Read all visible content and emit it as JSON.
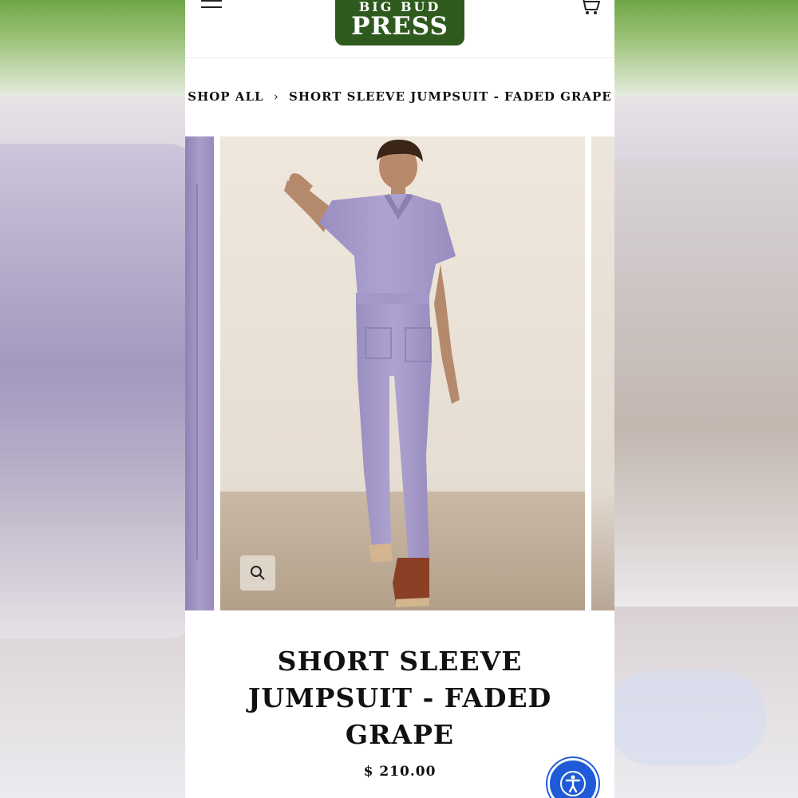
{
  "store": {
    "logo_line1": "BIG BUD",
    "logo_line2": "PRESS"
  },
  "breadcrumb": {
    "root": "SHOP ALL",
    "separator": "›",
    "current": "SHORT SLEEVE JUMPSUIT - FADED GRAPE"
  },
  "product": {
    "title": "SHORT SLEEVE JUMPSUIT - FADED GRAPE",
    "price": "$ 210.00",
    "image_alt": "Model wearing short sleeve jumpsuit in faded grape"
  },
  "icons": {
    "menu": "menu-icon",
    "cart": "cart-icon",
    "zoom": "search-icon",
    "accessibility": "accessibility-icon"
  },
  "colors": {
    "logo_bg": "#2f5a1e",
    "jumpsuit": "#a99dc9",
    "accessibility": "#1f5bd8"
  }
}
